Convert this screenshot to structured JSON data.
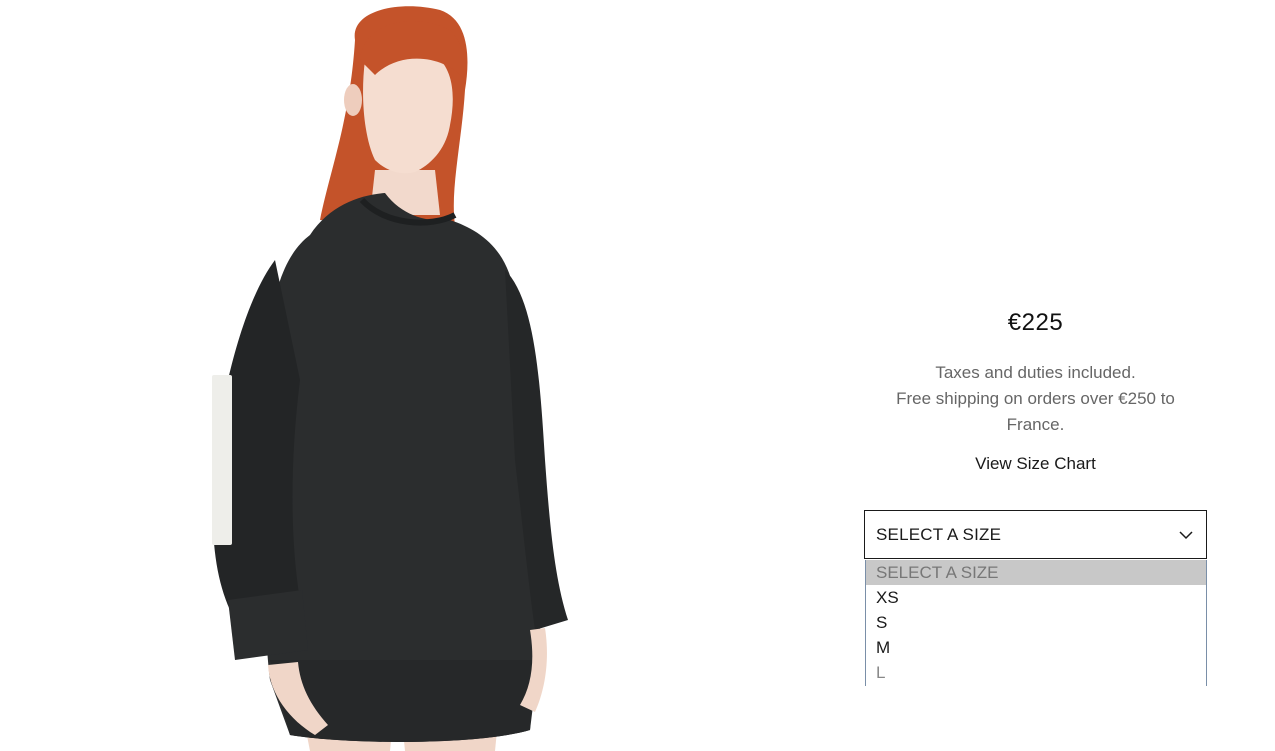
{
  "product": {
    "price": "€225",
    "tax_note": "Taxes and duties included.",
    "shipping_note": "Free shipping on orders over €250 to France.",
    "size_chart_label": "View Size Chart"
  },
  "size_select": {
    "value": "SELECT A SIZE",
    "options": [
      {
        "label": "SELECT A SIZE",
        "state": "selected"
      },
      {
        "label": "XS",
        "state": "normal"
      },
      {
        "label": "S",
        "state": "normal"
      },
      {
        "label": "M",
        "state": "normal"
      },
      {
        "label": "L",
        "state": "disabled"
      }
    ]
  },
  "colors": {
    "sweatshirt": "#2b2d2e",
    "hair": "#c4532a",
    "skin": "#f2d9cc",
    "dropdown_highlight": "#c8c8c8"
  }
}
